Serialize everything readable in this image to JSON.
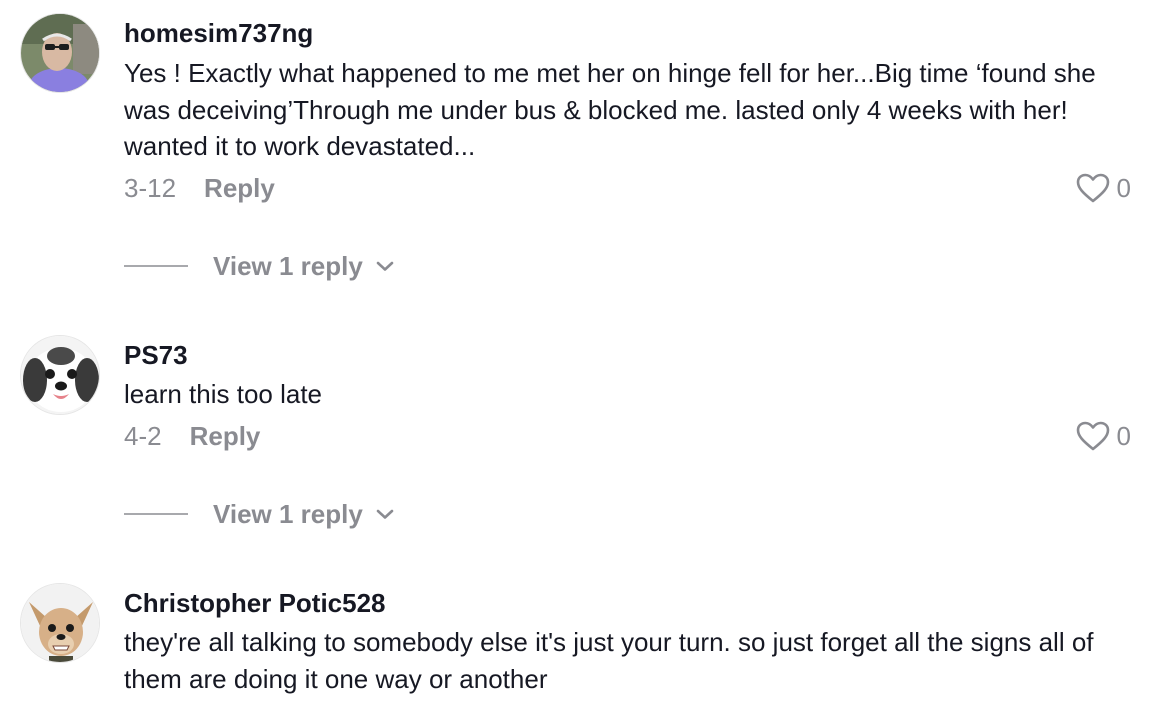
{
  "comments": [
    {
      "username": "homesim737ng",
      "text": "Yes ! Exactly what happened to me met her on hinge fell for her...Big time ‘found she was deceiving’Through me under bus & blocked me. lasted only 4 weeks with her! wanted it to work devastated...",
      "date": "3-12",
      "reply_label": "Reply",
      "like_count": "0",
      "view_replies_label": "View 1 reply",
      "avatar": "man-with-sunglasses-avatar"
    },
    {
      "username": "PS73",
      "text": "learn this too late",
      "date": "4-2",
      "reply_label": "Reply",
      "like_count": "0",
      "view_replies_label": "View 1 reply",
      "avatar": "shih-tzu-dog-avatar"
    },
    {
      "username": "Christopher Potic528",
      "text": "they're all talking to somebody else it's just your turn. so just forget all the signs all of them are doing it one way or another",
      "avatar": "chihuahua-dog-avatar"
    }
  ],
  "icons": {
    "like": "heart-outline-icon",
    "expand": "chevron-down-icon"
  },
  "colors": {
    "primary_text": "#161823",
    "secondary_text": "#8a8b91",
    "background": "#ffffff"
  }
}
